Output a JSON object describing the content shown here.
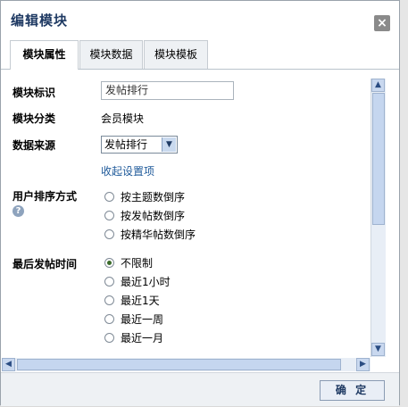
{
  "dialog": {
    "title": "编辑模块",
    "close_glyph": "×"
  },
  "tabs": [
    {
      "label": "模块属性",
      "active": true
    },
    {
      "label": "模块数据",
      "active": false
    },
    {
      "label": "模块模板",
      "active": false
    }
  ],
  "form": {
    "module_id_label": "模块标识",
    "module_id_value": "发帖排行",
    "module_category_label": "模块分类",
    "module_category_value": "会员模块",
    "data_source_label": "数据来源",
    "data_source_selected": "发帖排行",
    "collapse_link": "收起设置项",
    "user_sort_label": "用户排序方式",
    "user_sort_options": [
      "按主题数倒序",
      "按发帖数倒序",
      "按精华帖数倒序"
    ],
    "last_post_label": "最后发帖时间",
    "last_post_options": [
      "不限制",
      "最近1小时",
      "最近1天",
      "最近一周",
      "最近一月"
    ],
    "last_post_selected": "不限制"
  },
  "footer": {
    "confirm_label": "确 定"
  },
  "icons": {
    "help": "?",
    "scroll_up": "▲",
    "scroll_down": "▼",
    "scroll_left": "◀",
    "scroll_right": "▶",
    "dropdown": "▼"
  }
}
